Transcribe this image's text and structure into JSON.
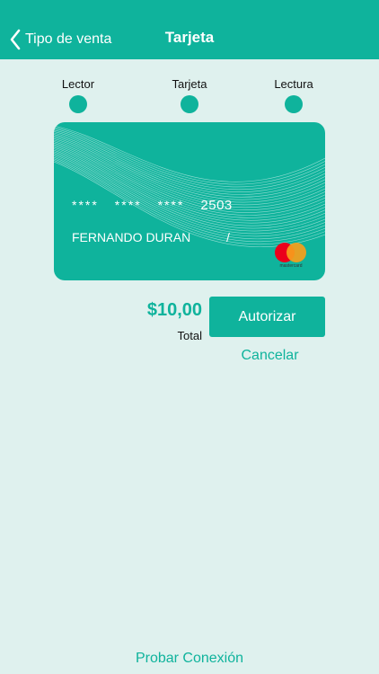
{
  "nav": {
    "back_label": "Tipo de venta",
    "title": "Tarjeta",
    "back_icon": "chevron-left-icon"
  },
  "steps": [
    {
      "label": "Lector"
    },
    {
      "label": "Tarjeta"
    },
    {
      "label": "Lectura"
    }
  ],
  "card": {
    "masked_groups": [
      "****",
      "****",
      "****"
    ],
    "last4": "2503",
    "holder": "FERNANDO DURAN",
    "expiry": "/",
    "brand": "mastercard"
  },
  "payment": {
    "amount": "$10,00",
    "total_label": "Total",
    "authorize_label": "Autorizar",
    "cancel_label": "Cancelar"
  },
  "footer": {
    "test_connection_label": "Probar Conexión"
  },
  "colors": {
    "accent": "#0fb39c",
    "background": "#dff1ee"
  }
}
